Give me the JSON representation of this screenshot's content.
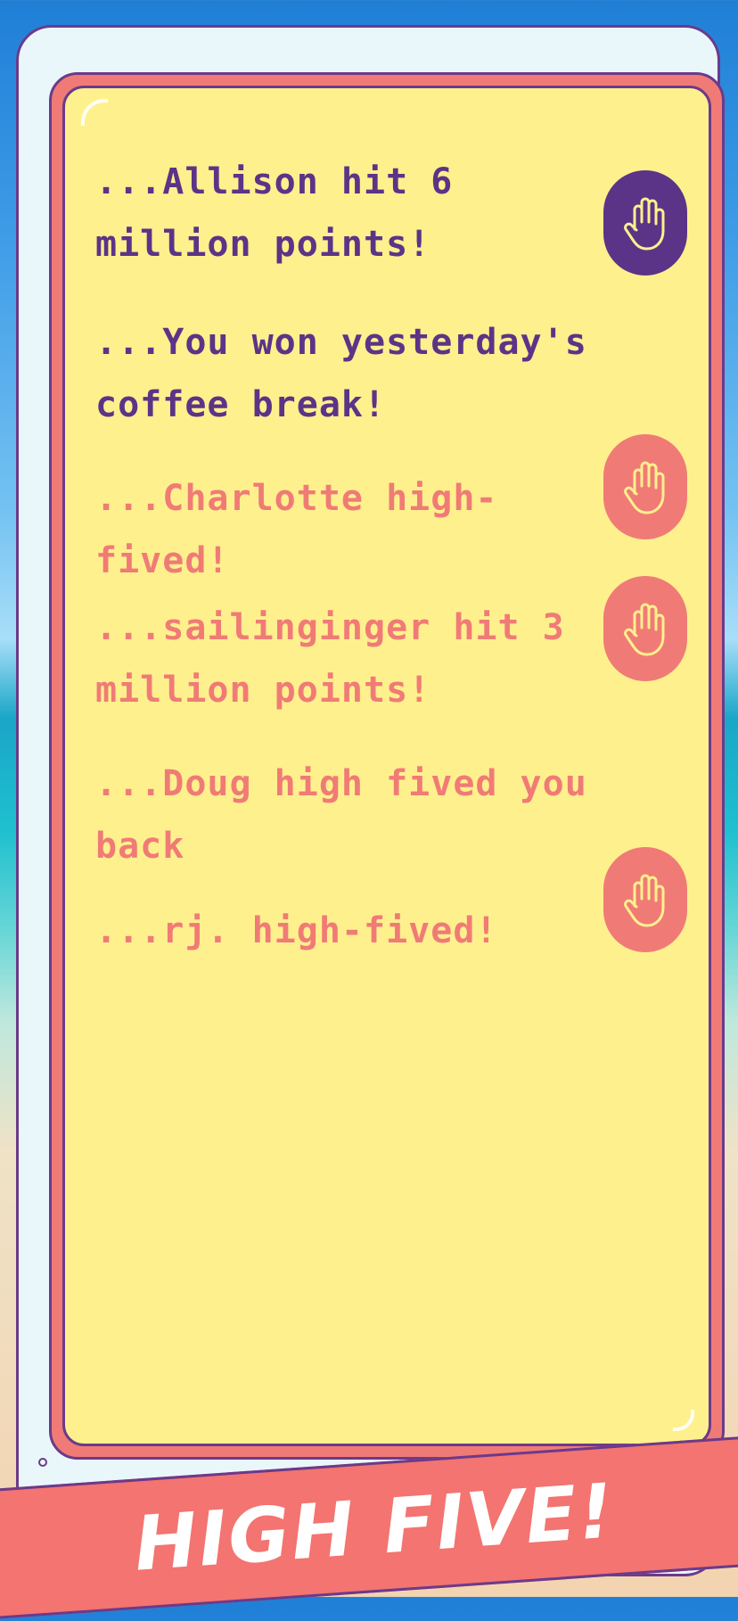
{
  "colors": {
    "purple": "#5b3487",
    "coral": "#f07b76",
    "screen_yellow": "#fff08e",
    "banner": "#f37470"
  },
  "feed": [
    {
      "text": "...Allison hit 6 million points!",
      "color": "purple",
      "has_high_five": true
    },
    {
      "text": "...You won yesterday's coffee break!",
      "color": "purple",
      "has_high_five": false
    },
    {
      "text": "...Charlotte high-fived!",
      "color": "coral",
      "has_high_five": true
    },
    {
      "text": "...sailinginger hit 3 million points!",
      "color": "coral",
      "has_high_five": true
    },
    {
      "text": "...Doug high fived you back",
      "color": "coral",
      "has_high_five": false
    },
    {
      "text": "...rj. high-fived!",
      "color": "coral",
      "has_high_five": true
    }
  ],
  "banner": {
    "label": "HIGH FIVE!"
  },
  "icons": {
    "high_five": "hand-icon"
  }
}
